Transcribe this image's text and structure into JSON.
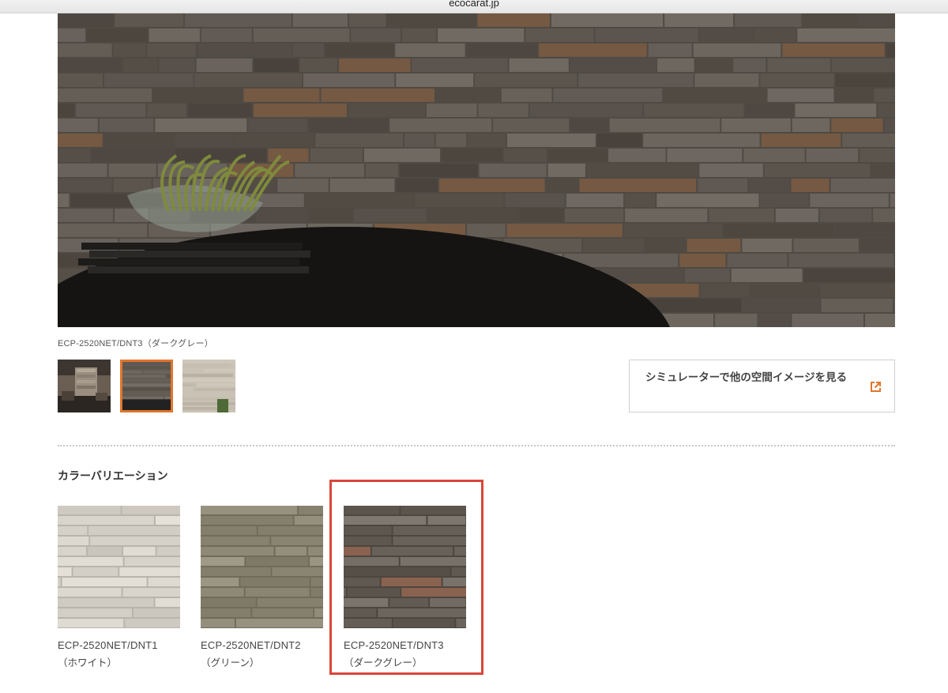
{
  "browser": {
    "url": "ecocarat.jp"
  },
  "hero": {
    "caption": "ECP-2520NET/DNT3（ダークグレー）"
  },
  "thumbnails": [
    {
      "label": "room-scene",
      "selected": false
    },
    {
      "label": "tile-closeup-dark-gray",
      "selected": true
    },
    {
      "label": "tile-wall-light",
      "selected": false
    }
  ],
  "simulator": {
    "label": "シミュレーターで他の空間イメージを見る",
    "icon": "external-link-icon"
  },
  "color_variation": {
    "title": "カラーバリエーション",
    "items": [
      {
        "code": "ECP-2520NET/DNT1",
        "name": "（ホワイト）",
        "tone": "white"
      },
      {
        "code": "ECP-2520NET/DNT2",
        "name": "（グリーン）",
        "tone": "green"
      },
      {
        "code": "ECP-2520NET/DNT3",
        "name": "（ダークグレー）",
        "tone": "dark-gray",
        "highlighted": true
      }
    ]
  },
  "colors": {
    "accent_orange": "#e0762c",
    "highlight_red": "#d9463a",
    "tile_white": "#d8d3ca",
    "tile_green": "#8f8a78",
    "tile_darkgray": "#6b645c"
  }
}
